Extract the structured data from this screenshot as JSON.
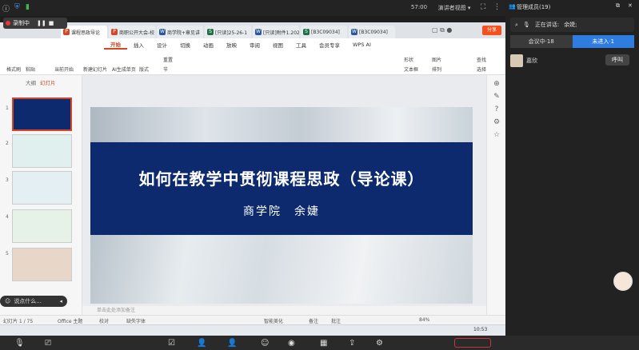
{
  "topbar": {
    "time": "57:00",
    "presenter_view": "演讲者视图"
  },
  "recording": {
    "label": "录制中"
  },
  "doc_tabs": [
    {
      "label": "课程思政导论",
      "color": "#d24726",
      "letter": "P",
      "active": true
    },
    {
      "label": "商职公开大会-校",
      "color": "#d24726",
      "letter": "P",
      "active": false
    },
    {
      "label": "商学院+章见讲",
      "color": "#2b579a",
      "letter": "W",
      "active": false
    },
    {
      "label": "[只读]25-26-1",
      "color": "#1e7145",
      "letter": "S",
      "active": false
    },
    {
      "label": "[只读]附件1.202",
      "color": "#2b579a",
      "letter": "W",
      "active": false
    },
    {
      "label": "[B3C09034]",
      "color": "#1e7145",
      "letter": "S",
      "active": false
    },
    {
      "label": "[B3C09034]",
      "color": "#2b579a",
      "letter": "W",
      "active": false
    }
  ],
  "share_label": "分享",
  "menu": [
    "开始",
    "插入",
    "设计",
    "切换",
    "动画",
    "放映",
    "审阅",
    "视图",
    "工具",
    "会员专享",
    "WPS AI"
  ],
  "ribbon": {
    "paste": "粘贴",
    "format_painter": "格式刷",
    "from_current": "当前开始",
    "new_slide": "新建幻灯片",
    "ai_slide": "AI生成单页",
    "layout": "版式",
    "section": "节",
    "reset": "重置",
    "shape": "形状",
    "picture": "图片",
    "find": "查找",
    "textbox": "文本框",
    "arrange": "排列",
    "replace": "替换",
    "select": "选择"
  },
  "side_tabs": {
    "outline": "大纲",
    "slides": "幻灯片"
  },
  "slide": {
    "title": "如何在教学中贯彻课程思政（导论课）",
    "subtitle": "商学院　余婕"
  },
  "notes_placeholder": "单击此处添加备注",
  "status": {
    "slide_count": "幻灯片 1 / 75",
    "theme": "Office 主题",
    "proofread": "校对",
    "missing_font": "缺失字体",
    "smart_beautify": "智能美化",
    "notes": "备注",
    "comment": "批注",
    "zoom": "84%"
  },
  "panel": {
    "title": "管理成员(19)",
    "speaking_label": "正在讲话:",
    "speaker": "余婕;",
    "tab_in_meeting": "会议中·18",
    "tab_not_joined": "未进入·1",
    "member_name": "嘉欣",
    "call_label": "呼叫"
  },
  "chat": {
    "placeholder": "说点什么..."
  },
  "taskbar_clock": "10:53",
  "icons": [
    "mic-off-icon",
    "camera-off-icon",
    "share-icon",
    "record-icon",
    "people-icon",
    "settings-icon"
  ]
}
